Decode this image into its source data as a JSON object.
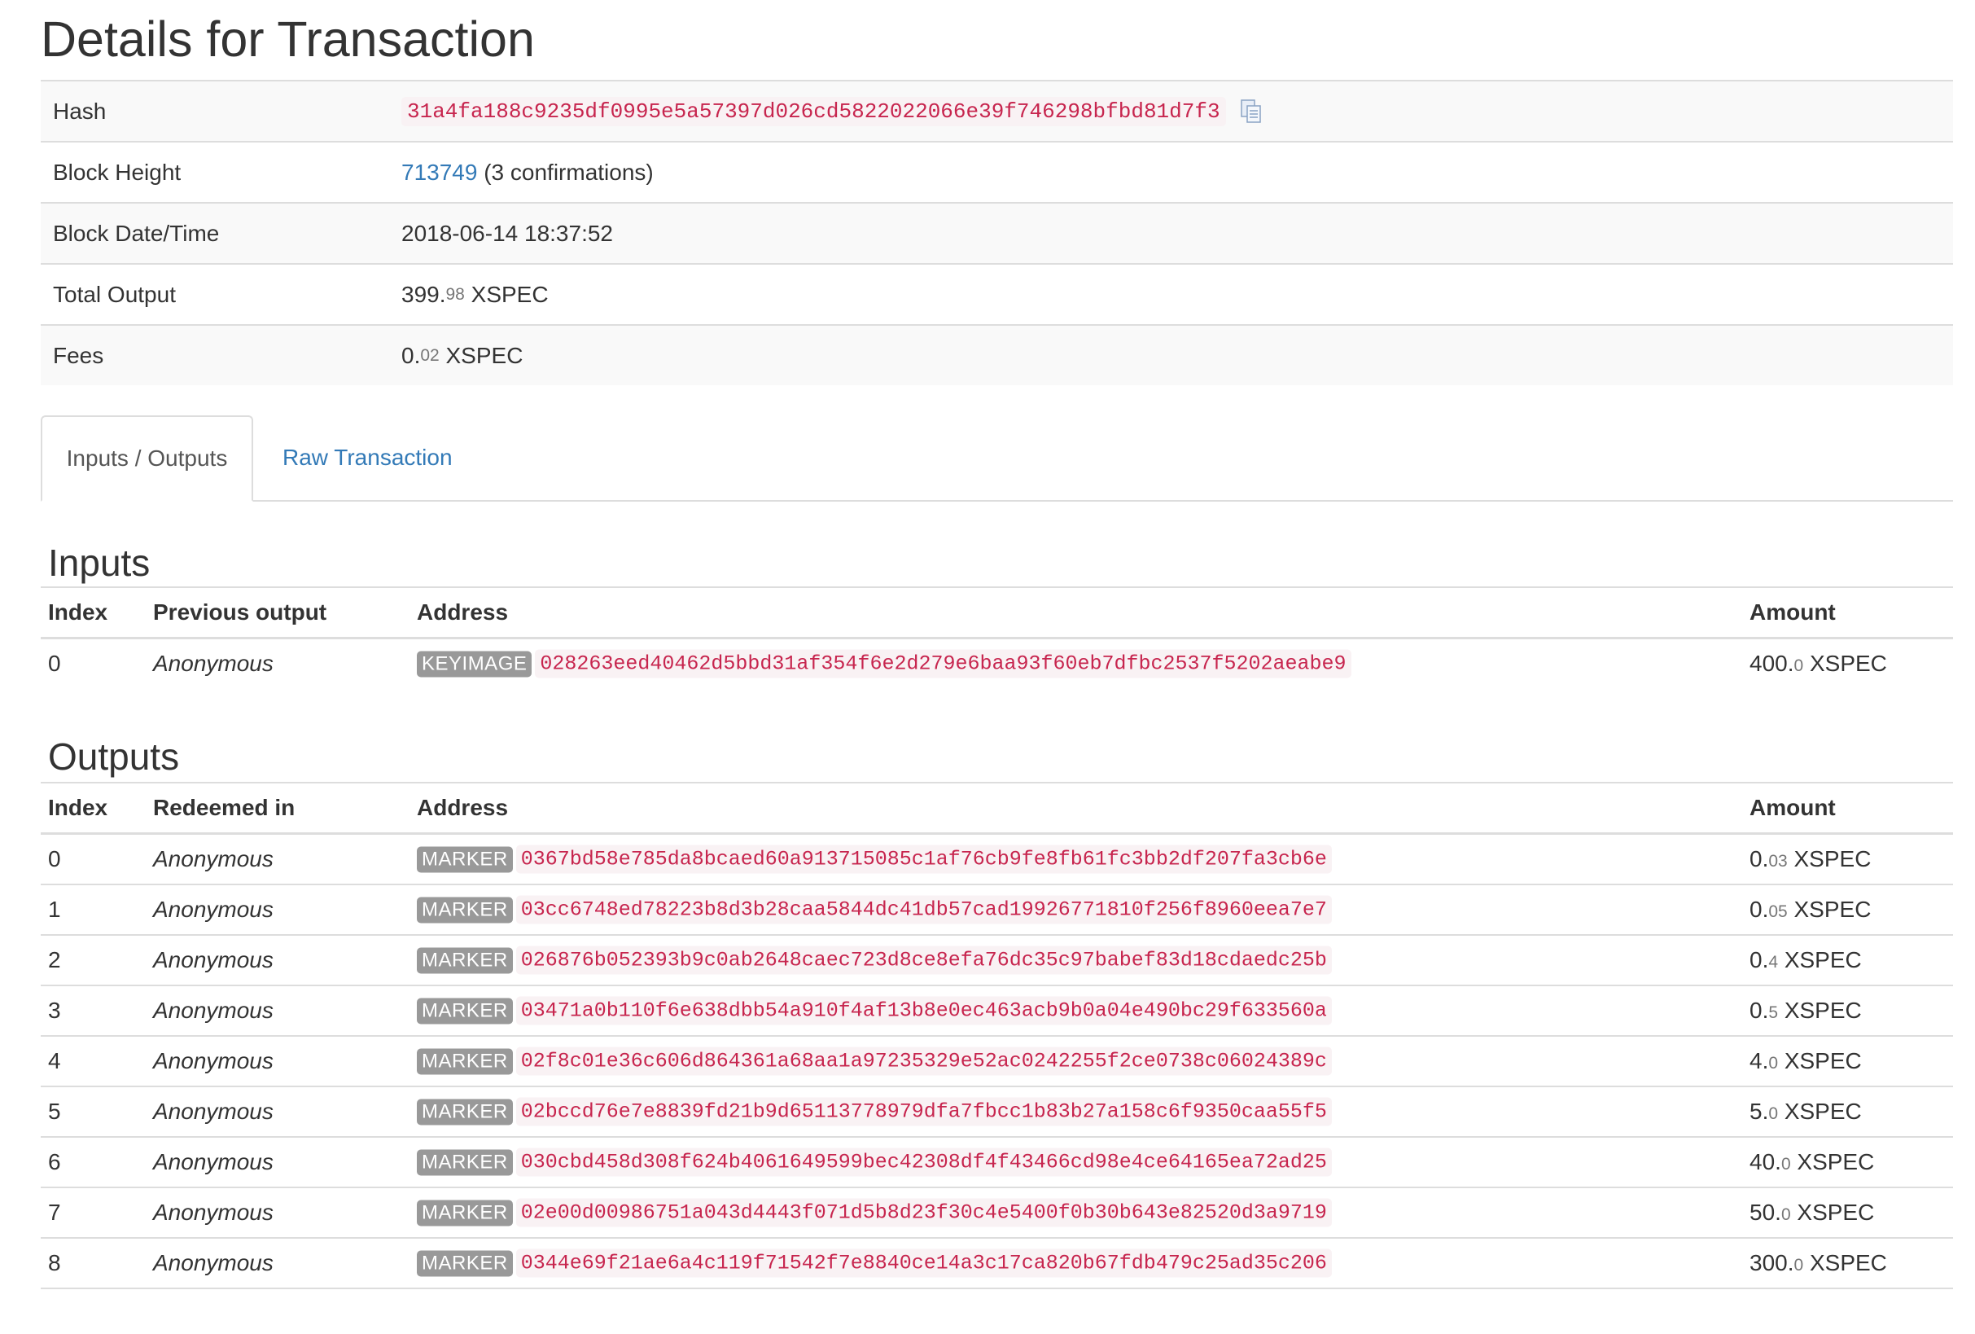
{
  "page": {
    "title": "Details for Transaction"
  },
  "details": {
    "hash_label": "Hash",
    "hash_value": "31a4fa188c9235df0995e5a57397d026cd5822022066e39f746298bfbd81d7f3",
    "block_height_label": "Block Height",
    "block_height_value": "713749",
    "block_height_suffix": "(3 confirmations)",
    "block_datetime_label": "Block Date/Time",
    "block_datetime_value": "2018-06-14 18:37:52",
    "total_output_label": "Total Output",
    "total_output_int": "399.",
    "total_output_frac": "98",
    "total_output_unit": "XSPEC",
    "fees_label": "Fees",
    "fees_int": "0.",
    "fees_frac": "02",
    "fees_unit": "XSPEC"
  },
  "tabs": {
    "active": "Inputs / Outputs",
    "raw": "Raw Transaction"
  },
  "inputs": {
    "heading": "Inputs",
    "headers": {
      "index": "Index",
      "prev": "Previous output",
      "address": "Address",
      "amount": "Amount"
    },
    "rows": [
      {
        "index": "0",
        "prev": "Anonymous",
        "badge": "KEYIMAGE",
        "address": "028263eed40462d5bbd31af354f6e2d279e6baa93f60eb7dfbc2537f5202aeabe9",
        "amount_int": "400.",
        "amount_frac": "0",
        "unit": "XSPEC"
      }
    ]
  },
  "outputs": {
    "heading": "Outputs",
    "headers": {
      "index": "Index",
      "redeemed": "Redeemed in",
      "address": "Address",
      "amount": "Amount"
    },
    "rows": [
      {
        "index": "0",
        "redeemed": "Anonymous",
        "badge": "MARKER",
        "address": "0367bd58e785da8bcaed60a913715085c1af76cb9fe8fb61fc3bb2df207fa3cb6e",
        "amount_int": "0.",
        "amount_frac": "03",
        "unit": "XSPEC"
      },
      {
        "index": "1",
        "redeemed": "Anonymous",
        "badge": "MARKER",
        "address": "03cc6748ed78223b8d3b28caa5844dc41db57cad19926771810f256f8960eea7e7",
        "amount_int": "0.",
        "amount_frac": "05",
        "unit": "XSPEC"
      },
      {
        "index": "2",
        "redeemed": "Anonymous",
        "badge": "MARKER",
        "address": "026876b052393b9c0ab2648caec723d8ce8efa76dc35c97babef83d18cdaedc25b",
        "amount_int": "0.",
        "amount_frac": "4",
        "unit": "XSPEC"
      },
      {
        "index": "3",
        "redeemed": "Anonymous",
        "badge": "MARKER",
        "address": "03471a0b110f6e638dbb54a910f4af13b8e0ec463acb9b0a04e490bc29f633560a",
        "amount_int": "0.",
        "amount_frac": "5",
        "unit": "XSPEC"
      },
      {
        "index": "4",
        "redeemed": "Anonymous",
        "badge": "MARKER",
        "address": "02f8c01e36c606d864361a68aa1a97235329e52ac0242255f2ce0738c06024389c",
        "amount_int": "4.",
        "amount_frac": "0",
        "unit": "XSPEC"
      },
      {
        "index": "5",
        "redeemed": "Anonymous",
        "badge": "MARKER",
        "address": "02bccd76e7e8839fd21b9d65113778979dfa7fbcc1b83b27a158c6f9350caa55f5",
        "amount_int": "5.",
        "amount_frac": "0",
        "unit": "XSPEC"
      },
      {
        "index": "6",
        "redeemed": "Anonymous",
        "badge": "MARKER",
        "address": "030cbd458d308f624b4061649599bec42308df4f43466cd98e4ce64165ea72ad25",
        "amount_int": "40.",
        "amount_frac": "0",
        "unit": "XSPEC"
      },
      {
        "index": "7",
        "redeemed": "Anonymous",
        "badge": "MARKER",
        "address": "02e00d00986751a043d4443f071d5b8d23f30c4e5400f0b30b643e82520d3a9719",
        "amount_int": "50.",
        "amount_frac": "0",
        "unit": "XSPEC"
      },
      {
        "index": "8",
        "redeemed": "Anonymous",
        "badge": "MARKER",
        "address": "0344e69f21ae6a4c119f71542f7e8840ce14a3c17ca820b67fdb479c25ad35c206",
        "amount_int": "300.",
        "amount_frac": "0",
        "unit": "XSPEC"
      }
    ]
  }
}
